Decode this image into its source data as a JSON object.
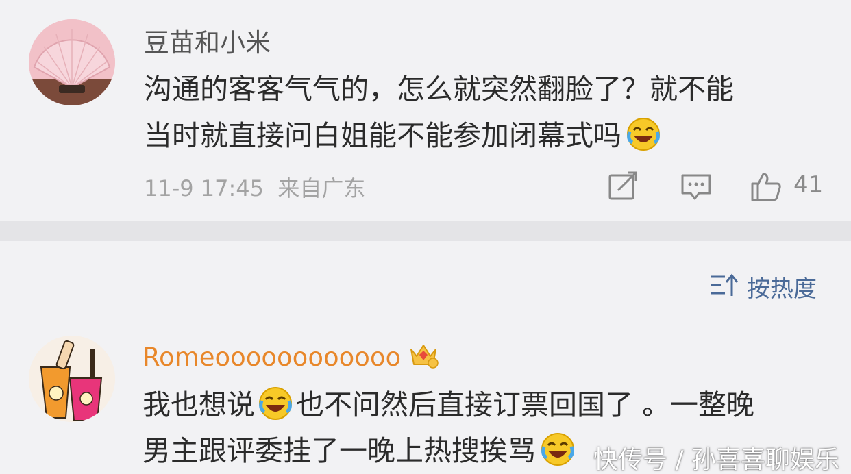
{
  "comments": [
    {
      "username": "豆苗和小米",
      "text_line1": "沟通的客客气气的，怎么就突然翻脸了？就不能",
      "text_line2": "当时就直接问白姐能不能参加闭幕式吗",
      "emoji": "laugh-cry-icon",
      "timestamp": "11-9 17:45",
      "location": "来自广东",
      "like_count": "41"
    },
    {
      "username": "Romeoooooooooooo",
      "badge": "crown-badge-icon",
      "text_part1": "我也想说",
      "text_part2": "也不问然后直接订票回国了 。一整晚",
      "text_line2": "男主跟评委挂了一晚上热搜挨骂",
      "emoji": "laugh-cry-icon"
    }
  ],
  "sort": {
    "label": "按热度"
  },
  "watermark": "快传号 / 孙喜喜聊娱乐",
  "colors": {
    "accent_blue": "#4a6a98",
    "username_orange": "#e8872a",
    "muted": "#a3a3a3"
  }
}
